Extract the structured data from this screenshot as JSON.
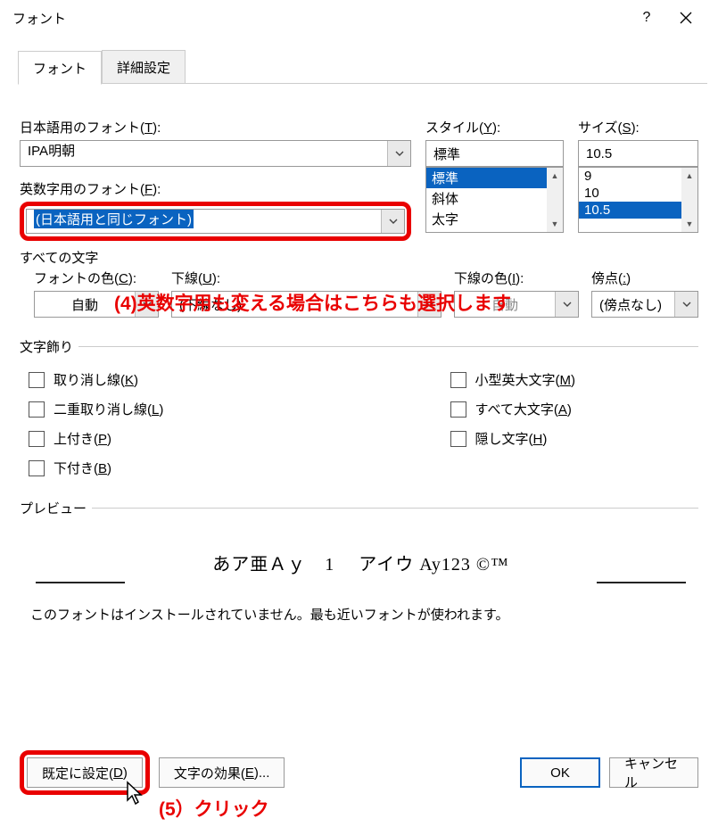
{
  "titlebar": {
    "title": "フォント"
  },
  "tabs": {
    "font": "フォント",
    "advanced": "詳細設定"
  },
  "labels": {
    "jp_font": "日本語用のフォント(T):",
    "jp_font_u": "T",
    "en_font": "英数字用のフォント(F):",
    "en_font_u": "F",
    "style": "スタイル(Y):",
    "style_u": "Y",
    "size": "サイズ(S):",
    "size_u": "S",
    "all_text": "すべての文字",
    "font_color": "フォントの色(C):",
    "underline": "下線(U):",
    "underline_color": "下線の色(I):",
    "emphasis": "傍点(:)"
  },
  "values": {
    "jp_font": "IPA明朝",
    "en_font": "(日本語用と同じフォント)",
    "style": "標準",
    "size": "10.5",
    "style_list": [
      "標準",
      "斜体",
      "太字"
    ],
    "size_list": [
      "9",
      "10",
      "10.5"
    ],
    "font_color": "自動",
    "underline": "(下線なし)",
    "underline_color": "自動",
    "emphasis": "(傍点なし)"
  },
  "decor": {
    "legend": "文字飾り",
    "strike": "取り消し線(K)",
    "dstrike": "二重取り消し線(L)",
    "super": "上付き(P)",
    "sub": "下付き(B)",
    "smallcaps": "小型英大文字(M)",
    "allcaps": "すべて大文字(A)",
    "hidden": "隠し文字(H)"
  },
  "preview": {
    "legend": "プレビュー",
    "text": "あア亜Ａｙ　1 　アイウ Ay123 ©™",
    "note": "このフォントはインストールされていません。最も近いフォントが使われます。"
  },
  "footer": {
    "default": "既定に設定(D)",
    "effects": "文字の効果(E)...",
    "ok": "OK",
    "cancel": "キャンセル"
  },
  "annotations": {
    "a4": "(4)英数字用も変える場合はこちらも選択します",
    "a5": "(5）クリック"
  }
}
